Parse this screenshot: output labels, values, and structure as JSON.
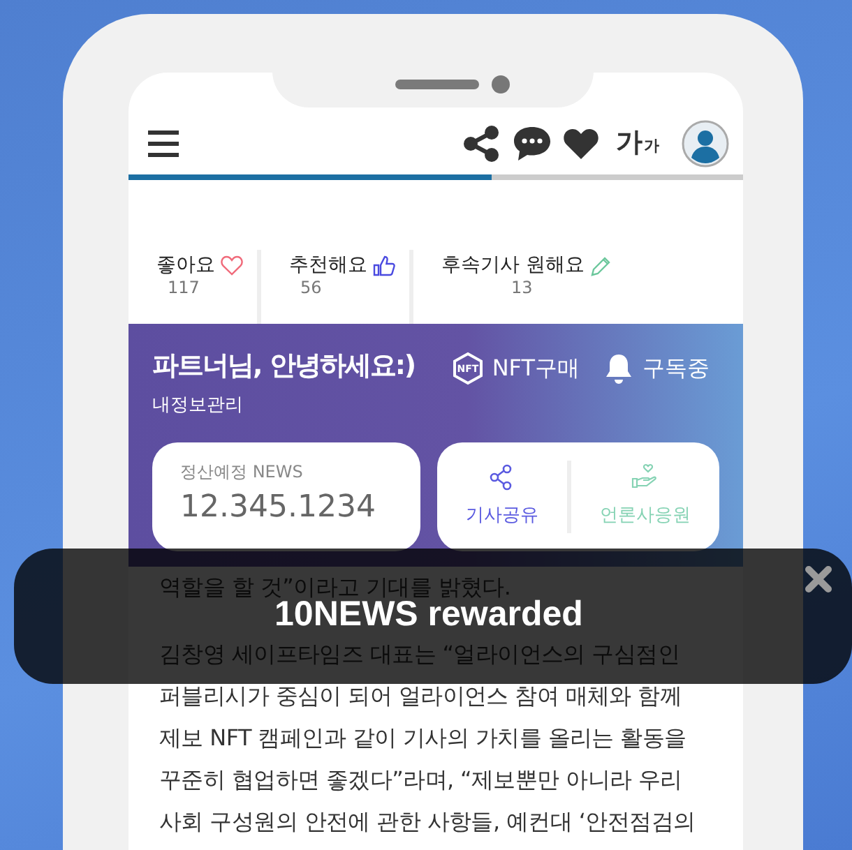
{
  "header": {
    "font_button": {
      "large": "가",
      "small": "가"
    },
    "progress": {
      "level": 0.59
    }
  },
  "reactions": [
    {
      "label": "좋아요",
      "count": "117",
      "kind": "heart"
    },
    {
      "label": "추천해요",
      "count": "56",
      "kind": "thumb"
    },
    {
      "label": "후속기사 원해요",
      "count": "13",
      "kind": "pencil"
    }
  ],
  "partner_card": {
    "greeting": "파트너님, 안녕하세요:)",
    "subtitle": "내정보관리",
    "actions": [
      {
        "label": "NFT구매",
        "kind": "nft",
        "icon_text": "NFT"
      },
      {
        "label": "구독중",
        "kind": "bell"
      }
    ],
    "balance": {
      "label": "정산예정 NEWS",
      "value": "12.345.1234"
    },
    "buttons": [
      {
        "label": "기사공유",
        "kind": "share"
      },
      {
        "label": "언론사응원",
        "kind": "support"
      }
    ]
  },
  "article": {
    "paragraphs": [
      {
        "lines": [
          "역할을 할 것”이라고 기대를 밝혔다."
        ]
      },
      {
        "lines": [
          "김창영 세이프타임즈 대표는 “얼라이언스의 구심점인",
          "퍼블리시가 중심이 되어 얼라이언스 참여 매체와 함께",
          "제보 NFT 캠페인과 같이 기사의 가치를 올리는 활동을",
          "꾸준히 협업하면 좋겠다”라며, “제보뿐만 아니라 우리",
          "사회 구성원의 안전에 관한 사항들, 예컨대 ‘안전점검의"
        ]
      }
    ]
  },
  "toast": {
    "message": "10NEWS rewarded"
  }
}
